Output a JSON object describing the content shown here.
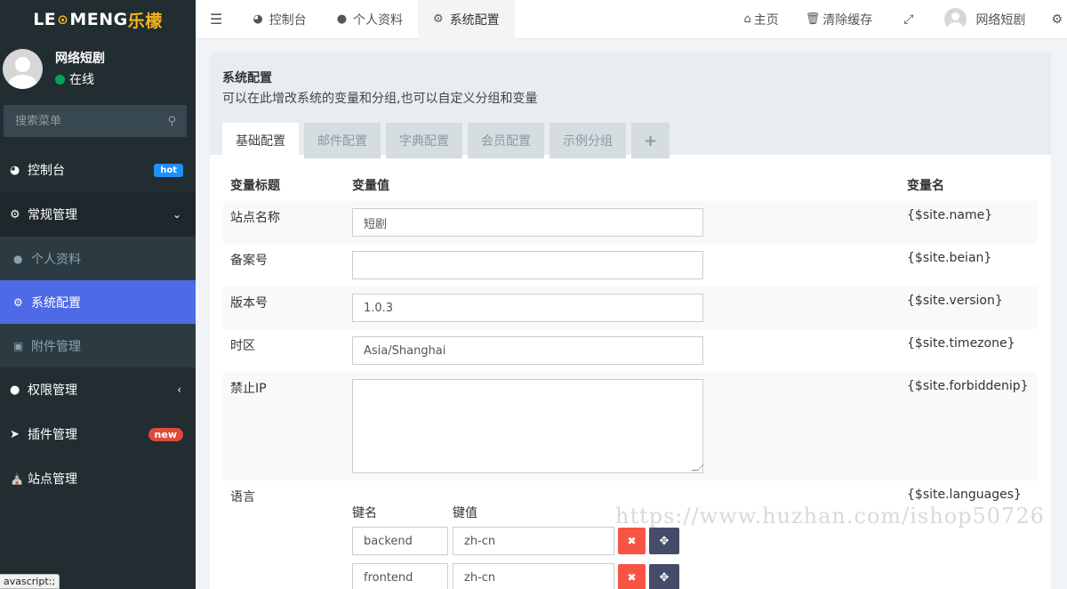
{
  "logo": {
    "part1": "LE",
    "part2": "MENG",
    "part3": "乐檬",
    "mid": "⊙"
  },
  "user": {
    "name": "网络短剧",
    "status": "在线"
  },
  "search": {
    "placeholder": "搜索菜单"
  },
  "sidebar": {
    "items": [
      {
        "label": "控制台",
        "icon": "dashboard-icon",
        "badge": "hot"
      },
      {
        "label": "常规管理",
        "icon": "cogs-icon"
      },
      {
        "label": "个人资料",
        "icon": "user-icon"
      },
      {
        "label": "系统配置",
        "icon": "gear-icon"
      },
      {
        "label": "附件管理",
        "icon": "image-icon"
      },
      {
        "label": "权限管理",
        "icon": "group-icon"
      },
      {
        "label": "插件管理",
        "icon": "rocket-icon",
        "badge": "new"
      },
      {
        "label": "站点管理",
        "icon": "bank-icon"
      }
    ]
  },
  "topbar": {
    "tabs": [
      {
        "label": "控制台",
        "icon": "dashboard-icon"
      },
      {
        "label": "个人资料",
        "icon": "user-icon"
      },
      {
        "label": "系统配置",
        "icon": "gear-icon"
      }
    ],
    "home": "主页",
    "clear_cache": "清除缓存",
    "username": "网络短剧"
  },
  "panel": {
    "title": "系统配置",
    "desc": "可以在此增改系统的变量和分组,也可以自定义分组和变量",
    "tabs": [
      "基础配置",
      "邮件配置",
      "字典配置",
      "会员配置",
      "示例分组",
      "+"
    ]
  },
  "table": {
    "headers": [
      "变量标题",
      "变量值",
      "变量名"
    ],
    "rows": [
      {
        "title": "站点名称",
        "value": "短剧",
        "var": "{$site.name}"
      },
      {
        "title": "备案号",
        "value": "",
        "var": "{$site.beian}"
      },
      {
        "title": "版本号",
        "value": "1.0.3",
        "var": "{$site.version}"
      },
      {
        "title": "时区",
        "value": "Asia/Shanghai",
        "var": "{$site.timezone}"
      },
      {
        "title": "禁止IP",
        "value": "",
        "var": "{$site.forbiddenip}"
      },
      {
        "title": "语言",
        "var": "{$site.languages}"
      }
    ],
    "kv_headers": [
      "键名",
      "键值"
    ],
    "kv_rows": [
      {
        "key": "backend",
        "val": "zh-cn"
      },
      {
        "key": "frontend",
        "val": "zh-cn"
      }
    ]
  },
  "watermark": "https://www.huzhan.com/ishop50726",
  "status_tip": "avascript:;"
}
